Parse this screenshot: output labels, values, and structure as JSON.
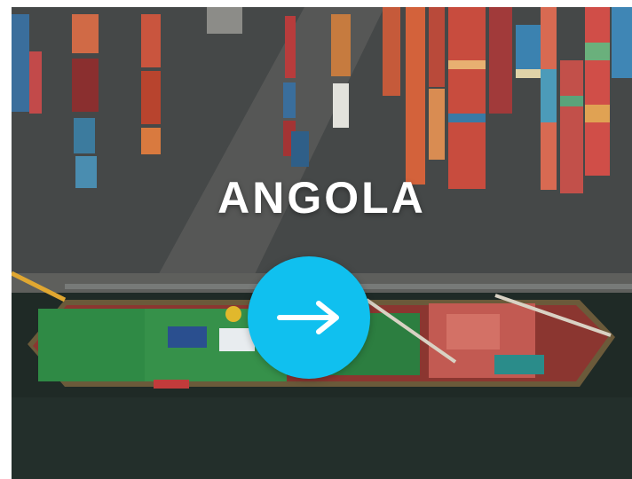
{
  "card": {
    "title": "ANGOLA",
    "button_icon": "arrow-right-icon"
  },
  "colors": {
    "accent": "#10c0ef",
    "title_text": "#ffffff",
    "water": "#1f2a26",
    "dock": "#4b4d4d",
    "ship_deck": "#2f8a45"
  }
}
